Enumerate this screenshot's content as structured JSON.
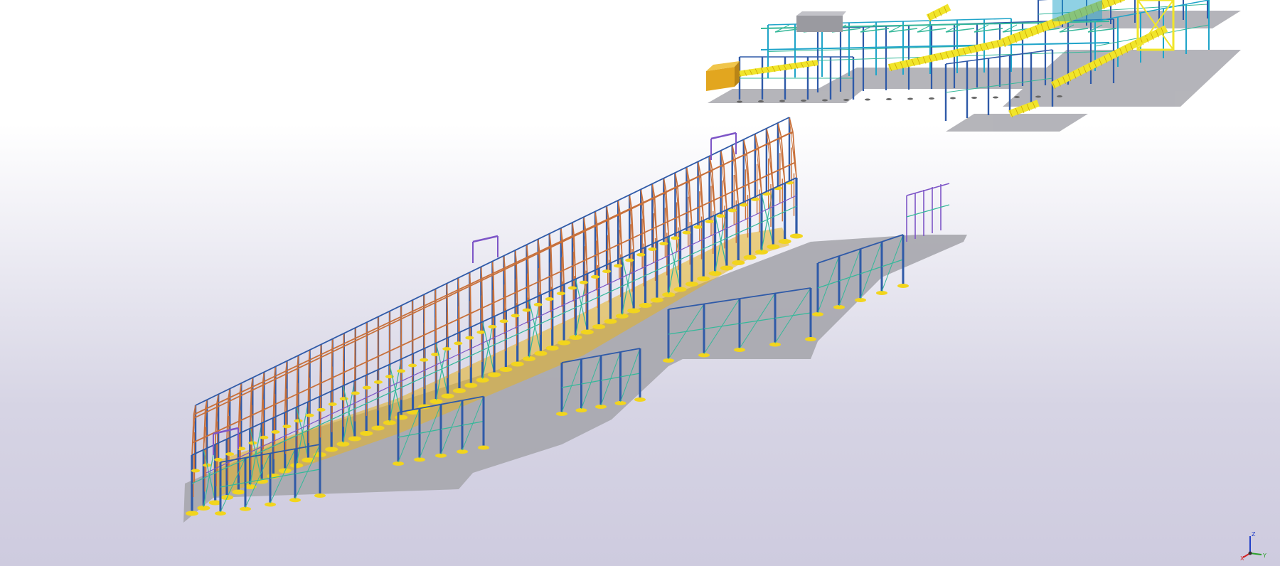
{
  "viewport": {
    "background_top": "#ffffff",
    "background_bottom": "#cecbdf"
  },
  "model": {
    "colors": {
      "column": "#2f5aa8",
      "truss": "#c8703a",
      "bracing": "#35b89a",
      "secondary": "#7d55c7",
      "base_plate": "#f2d51d",
      "slab": "#a4a4aa",
      "cladding": "#e6b320",
      "equipment": "#f1e52a",
      "cyan_frame": "#1fa4c9",
      "building_box": "#e2a61f"
    }
  },
  "axis_triad": {
    "z_label": "Z",
    "x_label": "X",
    "y_label": "Y",
    "z_color": "#2240c8",
    "x_color": "#d02525",
    "y_color": "#2aa02a"
  }
}
